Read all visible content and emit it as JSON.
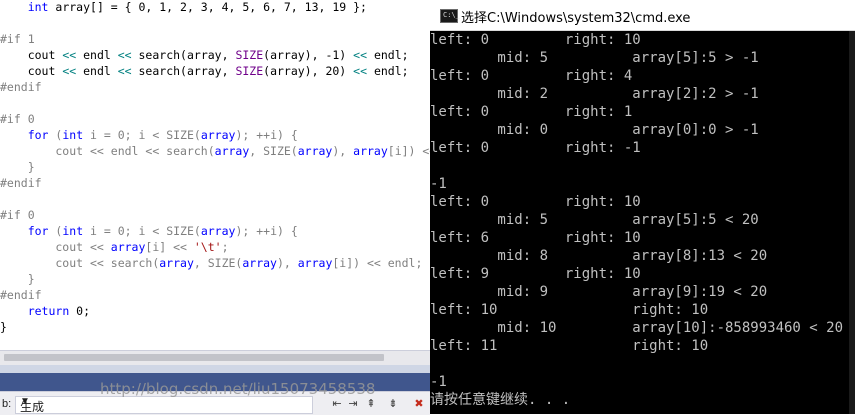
{
  "editor": {
    "lines": [
      {
        "tokens": [
          {
            "t": "    "
          },
          {
            "t": "int",
            "c": "kw"
          },
          {
            "t": " array[] = { 0, 1, 2, 3, 4, 5, 6, 7, 13, 19 };"
          }
        ]
      },
      {
        "tokens": [
          {
            "t": ""
          }
        ]
      },
      {
        "tokens": [
          {
            "t": "#if 1",
            "c": "gray"
          }
        ]
      },
      {
        "tokens": [
          {
            "t": "    cout "
          },
          {
            "t": "<<",
            "c": "op"
          },
          {
            "t": " endl "
          },
          {
            "t": "<<",
            "c": "op"
          },
          {
            "t": " search(array, "
          },
          {
            "t": "SIZE",
            "c": "macro"
          },
          {
            "t": "(array), -1) "
          },
          {
            "t": "<<",
            "c": "op"
          },
          {
            "t": " endl;"
          }
        ]
      },
      {
        "tokens": [
          {
            "t": "    cout "
          },
          {
            "t": "<<",
            "c": "op"
          },
          {
            "t": " endl "
          },
          {
            "t": "<<",
            "c": "op"
          },
          {
            "t": " search(array, "
          },
          {
            "t": "SIZE",
            "c": "macro"
          },
          {
            "t": "(array), 20) "
          },
          {
            "t": "<<",
            "c": "op"
          },
          {
            "t": " endl;"
          }
        ]
      },
      {
        "tokens": [
          {
            "t": "#endif",
            "c": "gray"
          }
        ]
      },
      {
        "tokens": [
          {
            "t": ""
          }
        ]
      },
      {
        "tokens": [
          {
            "t": "#if 0",
            "c": "gray"
          }
        ]
      },
      {
        "tokens": [
          {
            "t": "    "
          },
          {
            "t": "for",
            "c": "kw"
          },
          {
            "t": " (",
            "c": "gray"
          },
          {
            "t": "int",
            "c": "kw"
          },
          {
            "t": " i = 0; i < SIZE(",
            "c": "gray"
          },
          {
            "t": "array",
            "c": "kw"
          },
          {
            "t": "); ++i) {",
            "c": "gray"
          }
        ]
      },
      {
        "tokens": [
          {
            "t": "        cout << endl << search(",
            "c": "gray"
          },
          {
            "t": "array",
            "c": "kw"
          },
          {
            "t": ", SIZE(",
            "c": "gray"
          },
          {
            "t": "array",
            "c": "kw"
          },
          {
            "t": "), ",
            "c": "gray"
          },
          {
            "t": "array",
            "c": "kw"
          },
          {
            "t": "[i]) << endl;",
            "c": "gray"
          }
        ]
      },
      {
        "tokens": [
          {
            "t": "    }",
            "c": "gray"
          }
        ]
      },
      {
        "tokens": [
          {
            "t": "#endif",
            "c": "gray"
          }
        ]
      },
      {
        "tokens": [
          {
            "t": ""
          }
        ]
      },
      {
        "tokens": [
          {
            "t": "#if 0",
            "c": "gray"
          }
        ]
      },
      {
        "tokens": [
          {
            "t": "    "
          },
          {
            "t": "for",
            "c": "kw"
          },
          {
            "t": " (",
            "c": "gray"
          },
          {
            "t": "int",
            "c": "kw"
          },
          {
            "t": " i = 0; i < SIZE(",
            "c": "gray"
          },
          {
            "t": "array",
            "c": "kw"
          },
          {
            "t": "); ++i) {",
            "c": "gray"
          }
        ]
      },
      {
        "tokens": [
          {
            "t": "        cout << ",
            "c": "gray"
          },
          {
            "t": "array",
            "c": "kw"
          },
          {
            "t": "[i] << ",
            "c": "gray"
          },
          {
            "t": "'\\t'",
            "c": "str"
          },
          {
            "t": ";",
            "c": "gray"
          }
        ]
      },
      {
        "tokens": [
          {
            "t": "        cout << search(",
            "c": "gray"
          },
          {
            "t": "array",
            "c": "kw"
          },
          {
            "t": ", SIZE(",
            "c": "gray"
          },
          {
            "t": "array",
            "c": "kw"
          },
          {
            "t": "), ",
            "c": "gray"
          },
          {
            "t": "array",
            "c": "kw"
          },
          {
            "t": "[i]) << endl;",
            "c": "gray"
          }
        ]
      },
      {
        "tokens": [
          {
            "t": "    }",
            "c": "gray"
          }
        ]
      },
      {
        "tokens": [
          {
            "t": "#endif",
            "c": "gray"
          }
        ]
      },
      {
        "tokens": [
          {
            "t": "    "
          },
          {
            "t": "return",
            "c": "kw"
          },
          {
            "t": " 0;"
          }
        ]
      },
      {
        "tokens": [
          {
            "t": "}"
          }
        ]
      }
    ]
  },
  "output_panel": {
    "label": "b:",
    "select_value": "生成",
    "buttons": [
      "⇤",
      "⇥",
      "⇞",
      "⇟",
      "✖"
    ]
  },
  "cmd": {
    "title": "选择C:\\Windows\\system32\\cmd.exe",
    "icon_text": "C:\\_",
    "lines": [
      "left: 0         right: 10",
      "        mid: 5          array[5]:5 > -1",
      "left: 0         right: 4",
      "        mid: 2          array[2]:2 > -1",
      "left: 0         right: 1",
      "        mid: 0          array[0]:0 > -1",
      "left: 0         right: -1",
      "",
      "-1",
      "left: 0         right: 10",
      "        mid: 5          array[5]:5 < 20",
      "left: 6         right: 10",
      "        mid: 8          array[8]:13 < 20",
      "left: 9         right: 10",
      "        mid: 9          array[9]:19 < 20",
      "left: 10                right: 10",
      "        mid: 10         array[10]:-858993460 < 20",
      "left: 11                right: 10",
      "",
      "-1",
      "请按任意键继续. . ."
    ],
    "watermark": "http://blog.csdn.net/liu15073458538"
  },
  "colors": {
    "keyword": "#0000ff",
    "macro": "#6f008a",
    "string": "#a31515",
    "inactive": "#7f7f7f",
    "operator": "#008080",
    "console_text": "#c0c0c0",
    "console_bg": "#000000"
  }
}
